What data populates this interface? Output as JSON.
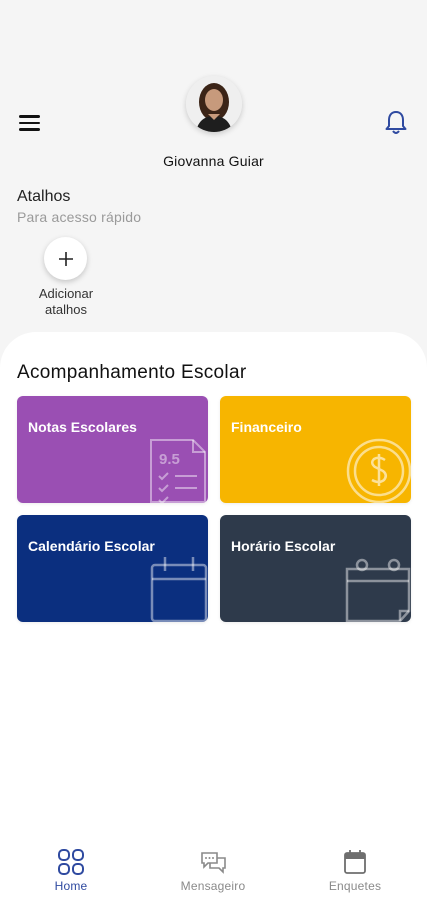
{
  "header": {
    "user_name": "Giovanna Guiar"
  },
  "shortcuts": {
    "title": "Atalhos",
    "subtitle": "Para acesso rápido",
    "add_label": "Adicionar atalhos"
  },
  "section": {
    "title": "Acompanhamento Escolar",
    "cards": [
      {
        "label": "Notas Escolares",
        "color": "#9a4fb3",
        "icon": "report-card-icon",
        "grade": "9.5"
      },
      {
        "label": "Financeiro",
        "color": "#f7b500",
        "icon": "dollar-coin-icon"
      },
      {
        "label": "Calendário Escolar",
        "color": "#0b2f7f",
        "icon": "calendar-icon"
      },
      {
        "label": "Horário Escolar",
        "color": "#2e3a4b",
        "icon": "schedule-icon"
      }
    ]
  },
  "bottom_nav": {
    "items": [
      {
        "label": "Home",
        "icon": "home-grid-icon",
        "active": true,
        "color": "#2f4aa0"
      },
      {
        "label": "Mensageiro",
        "icon": "chat-bubbles-icon",
        "active": false
      },
      {
        "label": "Enquetes",
        "icon": "calendar-icon",
        "active": false
      }
    ]
  }
}
